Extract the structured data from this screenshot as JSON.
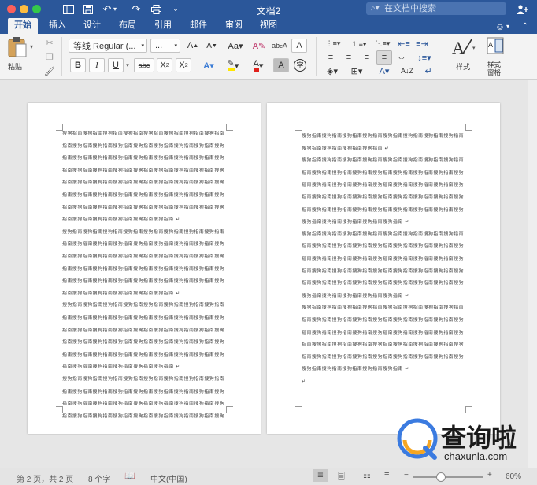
{
  "window": {
    "title": "文档2",
    "search_placeholder": "在文档中搜索"
  },
  "tabs": [
    {
      "label": "开始"
    },
    {
      "label": "插入"
    },
    {
      "label": "设计"
    },
    {
      "label": "布局"
    },
    {
      "label": "引用"
    },
    {
      "label": "邮件"
    },
    {
      "label": "审阅"
    },
    {
      "label": "视图"
    }
  ],
  "ribbon": {
    "paste_label": "粘贴",
    "font_name": "等线 Regular (...",
    "font_size": "...",
    "styles_label": "样式",
    "styles_pane_label_1": "样式",
    "styles_pane_label_2": "窗格"
  },
  "document": {
    "page1_lines": [
      "搜狗指南搜狗指南搜狗指南搜狗指南搜狗指南搜狗指南搜狗指南搜狗指南",
      "指南搜狗指南搜狗指南搜狗指南搜狗指南搜狗指南搜狗指南搜狗指南搜狗",
      "指南搜狗指南搜狗指南搜狗指南搜狗指南搜狗指南搜狗指南搜狗指南搜狗",
      "指南搜狗指南搜狗指南搜狗指南搜狗指南搜狗指南搜狗指南搜狗指南搜狗",
      "指南搜狗指南搜狗指南搜狗指南搜狗指南搜狗指南搜狗指南搜狗指南搜狗",
      "指南搜狗指南搜狗指南搜狗指南搜狗指南搜狗指南搜狗指南搜狗指南搜狗",
      "指南搜狗指南搜狗指南搜狗指南搜狗指南搜狗指南搜狗指南搜狗指南搜狗",
      "指南搜狗指南搜狗指南搜狗指南搜狗指南搜狗指南 ↵",
      "搜狗指南搜狗指南搜狗指南搜狗指南搜狗指南搜狗指南搜狗指南搜狗指南",
      "指南搜狗指南搜狗指南搜狗指南搜狗指南搜狗指南搜狗指南搜狗指南搜狗",
      "指南搜狗指南搜狗指南搜狗指南搜狗指南搜狗指南搜狗指南搜狗指南搜狗",
      "指南搜狗指南搜狗指南搜狗指南搜狗指南搜狗指南搜狗指南搜狗指南搜狗",
      "指南搜狗指南搜狗指南搜狗指南搜狗指南搜狗指南搜狗指南搜狗指南搜狗",
      "指南搜狗指南搜狗指南搜狗指南搜狗指南搜狗指南 ↵",
      "搜狗指南搜狗指南搜狗指南搜狗指南搜狗指南搜狗指南搜狗指南搜狗指南",
      "指南搜狗指南搜狗指南搜狗指南搜狗指南搜狗指南搜狗指南搜狗指南搜狗",
      "指南搜狗指南搜狗指南搜狗指南搜狗指南搜狗指南搜狗指南搜狗指南搜狗",
      "指南搜狗指南搜狗指南搜狗指南搜狗指南搜狗指南搜狗指南搜狗指南搜狗",
      "指南搜狗指南搜狗指南搜狗指南搜狗指南搜狗指南搜狗指南搜狗指南搜狗",
      "指南搜狗指南搜狗指南搜狗指南搜狗指南搜狗指南 ↵",
      "搜狗指南搜狗指南搜狗指南搜狗指南搜狗指南搜狗指南搜狗指南搜狗指南",
      "指南搜狗指南搜狗指南搜狗指南搜狗指南搜狗指南搜狗指南搜狗指南搜狗",
      "指南搜狗指南搜狗指南搜狗指南搜狗指南搜狗指南搜狗指南搜狗指南搜狗",
      "指南搜狗指南搜狗指南搜狗指南搜狗指南搜狗指南搜狗指南搜狗指南搜狗"
    ],
    "page2_lines": [
      "搜狗指南搜狗指南搜狗指南搜狗指南搜狗指南搜狗指南搜狗指南搜狗指南",
      "搜狗指南搜狗指南搜狗指南搜狗指南 ↵",
      "搜狗指南搜狗指南搜狗指南搜狗指南搜狗指南搜狗指南搜狗指南搜狗指南",
      "指南搜狗指南搜狗指南搜狗指南搜狗指南搜狗指南搜狗指南搜狗指南搜狗",
      "指南搜狗指南搜狗指南搜狗指南搜狗指南搜狗指南搜狗指南搜狗指南搜狗",
      "指南搜狗指南搜狗指南搜狗指南搜狗指南搜狗指南搜狗指南搜狗指南搜狗",
      "指南搜狗指南搜狗指南搜狗指南搜狗指南搜狗指南搜狗指南搜狗指南搜狗",
      "搜狗指南搜狗指南搜狗指南搜狗指南搜狗指南 ↵",
      "搜狗指南搜狗指南搜狗指南搜狗指南搜狗指南搜狗指南搜狗指南搜狗指南",
      "指南搜狗指南搜狗指南搜狗指南搜狗指南搜狗指南搜狗指南搜狗指南搜狗",
      "指南搜狗指南搜狗指南搜狗指南搜狗指南搜狗指南搜狗指南搜狗指南搜狗",
      "指南搜狗指南搜狗指南搜狗指南搜狗指南搜狗指南搜狗指南搜狗指南搜狗",
      "指南搜狗指南搜狗指南搜狗指南搜狗指南搜狗指南搜狗指南搜狗指南搜狗",
      "搜狗指南搜狗指南搜狗指南搜狗指南搜狗指南 ↵",
      "搜狗指南搜狗指南搜狗指南搜狗指南搜狗指南搜狗指南搜狗指南搜狗指南",
      "指南搜狗指南搜狗指南搜狗指南搜狗指南搜狗指南搜狗指南搜狗指南搜狗",
      "指南搜狗指南搜狗指南搜狗指南搜狗指南搜狗指南搜狗指南搜狗指南搜狗",
      "指南搜狗指南搜狗指南搜狗指南搜狗指南搜狗指南搜狗指南搜狗指南搜狗",
      "指南搜狗指南搜狗指南搜狗指南搜狗指南搜狗指南搜狗指南搜狗指南搜狗",
      "搜狗指南搜狗指南搜狗指南搜狗指南搜狗指南 ↵",
      "↵"
    ]
  },
  "status": {
    "page_info": "第 2 页，共 2 页",
    "word_count": "8 个字",
    "language": "中文(中国)",
    "zoom": "60%"
  },
  "watermark": {
    "text": "查询啦",
    "url": "chaxunla.com"
  },
  "colors": {
    "accent": "#2b579a",
    "ribbon_bg": "#f3f3f3",
    "canvas_bg": "#e6e6e6"
  }
}
